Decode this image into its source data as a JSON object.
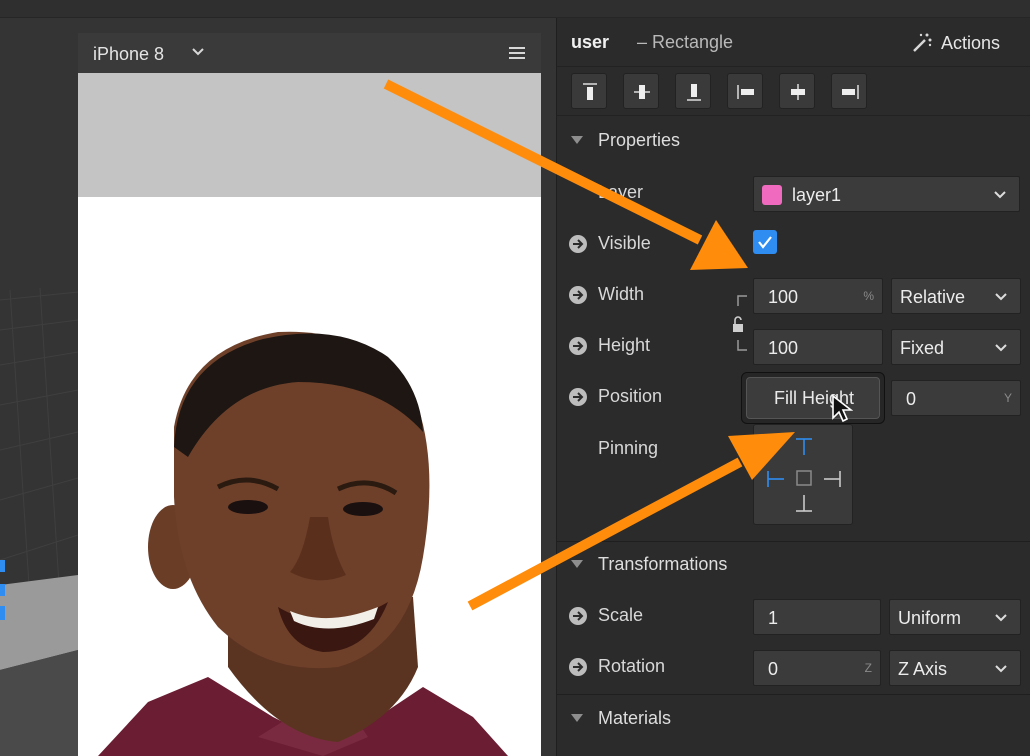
{
  "device": {
    "name": "iPhone 8"
  },
  "inspector": {
    "object_name": "user",
    "object_type": "– Rectangle",
    "actions_label": "Actions",
    "alignment_icons": [
      "align-top-icon",
      "align-vertical-center-icon",
      "align-bottom-icon",
      "align-left-icon",
      "align-horizontal-center-icon",
      "align-right-icon"
    ],
    "properties": {
      "title": "Properties",
      "layer_label": "Layer",
      "layer_value": "layer1",
      "layer_color": "#f06bbf",
      "visible_label": "Visible",
      "visible_checked": true,
      "width_label": "Width",
      "width_value": "100",
      "width_unit": "%",
      "width_mode": "Relative",
      "height_label": "Height",
      "height_value": "100",
      "height_mode": "Fixed",
      "position_label": "Position",
      "position_y_value": "0",
      "position_y_unit": "Y",
      "fill_height_label": "Fill Height",
      "pinning_label": "Pinning"
    },
    "transformations": {
      "title": "Transformations",
      "scale_label": "Scale",
      "scale_value": "1",
      "scale_mode": "Uniform",
      "rotation_label": "Rotation",
      "rotation_value": "0",
      "rotation_unit": "Z",
      "rotation_axis": "Z Axis"
    },
    "materials": {
      "title": "Materials"
    }
  },
  "colors": {
    "accent": "#2f8cf0",
    "annotation_arrow": "#ff8c0a",
    "panel_bg": "#2b2b2b",
    "field_bg": "#3b3b3b"
  }
}
